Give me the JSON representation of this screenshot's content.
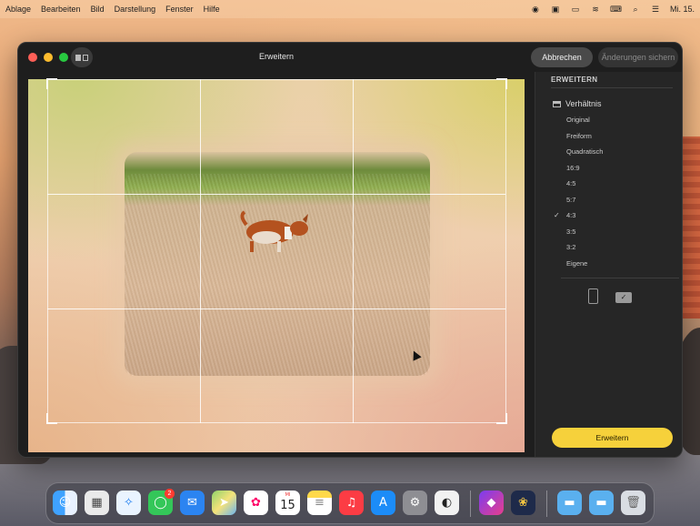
{
  "menubar": {
    "items": [
      "Ablage",
      "Bearbeiten",
      "Bild",
      "Darstellung",
      "Fenster",
      "Hilfe"
    ],
    "clock": "Mi. 15.",
    "status_icons": [
      "screen-record-icon",
      "finder-status-icon",
      "battery-icon",
      "wifi-icon",
      "keyboard-icon",
      "search-icon",
      "control-center-icon"
    ]
  },
  "window": {
    "title": "Erweitern",
    "cancel_label": "Abbrechen",
    "save_label": "Änderungen sichern"
  },
  "sidebar": {
    "section_title": "ERWEITERN",
    "ratio_title": "Verhältnis",
    "options": [
      "Original",
      "Freiform",
      "Quadratisch",
      "16:9",
      "4:5",
      "5:7",
      "4:3",
      "3:5",
      "3:2",
      "Eigene"
    ],
    "selected_option": "4:3",
    "check_mark": "✓",
    "orientation_selected": "landscape",
    "expand_label": "Erweitern"
  },
  "dock": {
    "messages_badge": "2",
    "calendar_month": "MI",
    "calendar_day": "15",
    "apps": [
      "finder",
      "launchpad",
      "safari",
      "messages",
      "mail",
      "maps",
      "photos",
      "calendar",
      "notes",
      "music",
      "app-store",
      "system-settings",
      "camo",
      "shortcuts",
      "tes",
      "folder",
      "folder",
      "trash"
    ]
  },
  "colors": {
    "accent_yellow": "#f6d13b",
    "window_bg": "#1e1e1e",
    "sidebar_bg": "#262626"
  }
}
